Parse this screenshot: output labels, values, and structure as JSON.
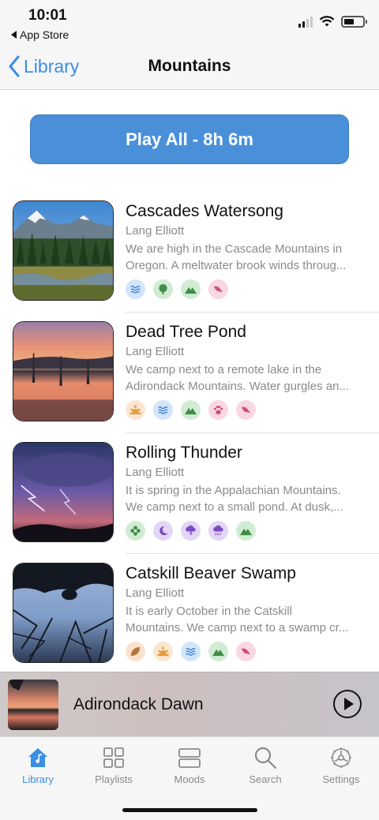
{
  "status_bar": {
    "time": "10:01",
    "back_app": "App Store"
  },
  "nav": {
    "back_label": "Library",
    "title": "Mountains"
  },
  "play_all": {
    "label": "Play All - 8h 6m"
  },
  "tracks": [
    {
      "title": "Cascades Watersong",
      "artist": "Lang Elliott",
      "desc_line1": "We are high in the Cascade Mountains in",
      "desc_line2": "Oregon. A meltwater brook winds throug...",
      "tags": [
        "water-icon",
        "tree-icon",
        "mountain-icon",
        "bird-icon"
      ]
    },
    {
      "title": "Dead Tree Pond",
      "artist": "Lang Elliott",
      "desc_line1": "We camp next to a remote lake in the",
      "desc_line2": "Adirondack Mountains. Water gurgles an...",
      "tags": [
        "sunrise-icon",
        "water-icon",
        "mountain-icon",
        "paw-icon",
        "bird-icon"
      ]
    },
    {
      "title": "Rolling Thunder",
      "artist": "Lang Elliott",
      "desc_line1": "It is spring in the Appalachian Mountains.",
      "desc_line2": "We camp next to a small pond. At dusk,...",
      "tags": [
        "flower-icon",
        "moon-icon",
        "storm-icon",
        "rain-icon",
        "mountain-icon"
      ]
    },
    {
      "title": "Catskill Beaver Swamp",
      "artist": "Lang Elliott",
      "desc_line1": "It is early October in the Catskill",
      "desc_line2": "Mountains. We camp next to a swamp cr...",
      "tags": [
        "leaf-icon",
        "sunrise-icon",
        "water-icon",
        "mountain-icon",
        "bird-icon"
      ]
    }
  ],
  "mini_player": {
    "title": "Adirondack Dawn"
  },
  "tab_bar": {
    "tabs": [
      {
        "label": "Library",
        "icon": "house-icon",
        "active": true
      },
      {
        "label": "Playlists",
        "icon": "grid-icon",
        "active": false
      },
      {
        "label": "Moods",
        "icon": "stack-icon",
        "active": false
      },
      {
        "label": "Search",
        "icon": "search-icon",
        "active": false
      },
      {
        "label": "Settings",
        "icon": "gear-icon",
        "active": false
      }
    ]
  },
  "colors": {
    "accent": "#3a8ee6",
    "play_button": "#4a90d9"
  }
}
